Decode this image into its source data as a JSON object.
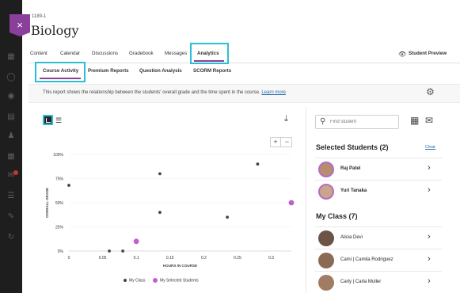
{
  "header": {
    "course_id": "1189-1",
    "course_title": "Biology",
    "student_preview": "Student Preview"
  },
  "main_nav": [
    "Content",
    "Calendar",
    "Discussions",
    "Gradebook",
    "Messages",
    "Analytics"
  ],
  "sub_nav": [
    "Course Activity",
    "Premium Reports",
    "Question Analysis",
    "SCORM Reports"
  ],
  "description": {
    "text": "This report shows the relationship between the students' overall grade and the time spent in the course.",
    "link": "Learn more"
  },
  "zoom": {
    "plus": "+",
    "minus": "−"
  },
  "legend": {
    "class_label": "My Class",
    "selected_label": "My Selected Students"
  },
  "search": {
    "placeholder": "Find student"
  },
  "selected": {
    "title": "Selected Students (2)",
    "clear": "Clear",
    "students": [
      "Raj Patel",
      "Yuri Tanaka"
    ]
  },
  "my_class": {
    "title": "My Class (7)",
    "students": [
      "Alicia Devi",
      "Cami | Camila Rodriguez",
      "Carly | Carla Muller"
    ]
  },
  "colors": {
    "accent": "#8a3f9a",
    "highlight": "#2bbfd3",
    "selected_point": "#c060d0",
    "class_point": "#444444"
  },
  "icons": [
    "close-icon",
    "eye-icon",
    "settings-icon",
    "chart-view-icon",
    "list-view-icon",
    "download-icon",
    "search-icon",
    "calendar-icon",
    "mail-icon",
    "chevron-right-icon"
  ],
  "chart_data": {
    "type": "scatter",
    "xlabel": "HOURS IN COURSE",
    "ylabel": "OVERALL GRADE",
    "x_ticks": [
      "0",
      "0.05",
      "0.1",
      "0.15",
      "0.2",
      "0.25",
      "0.3"
    ],
    "y_ticks": [
      "0%",
      "25%",
      "50%",
      "75%",
      "100%"
    ],
    "xlim": [
      0,
      0.33
    ],
    "ylim": [
      0,
      100
    ],
    "series": [
      {
        "name": "My Class",
        "points": [
          [
            0,
            68
          ],
          [
            0.06,
            0
          ],
          [
            0.08,
            0
          ],
          [
            0.135,
            80
          ],
          [
            0.135,
            40
          ],
          [
            0.235,
            35
          ],
          [
            0.28,
            90
          ]
        ]
      },
      {
        "name": "My Selected Students",
        "points": [
          [
            0.1,
            10
          ],
          [
            0.33,
            50
          ]
        ]
      }
    ]
  }
}
